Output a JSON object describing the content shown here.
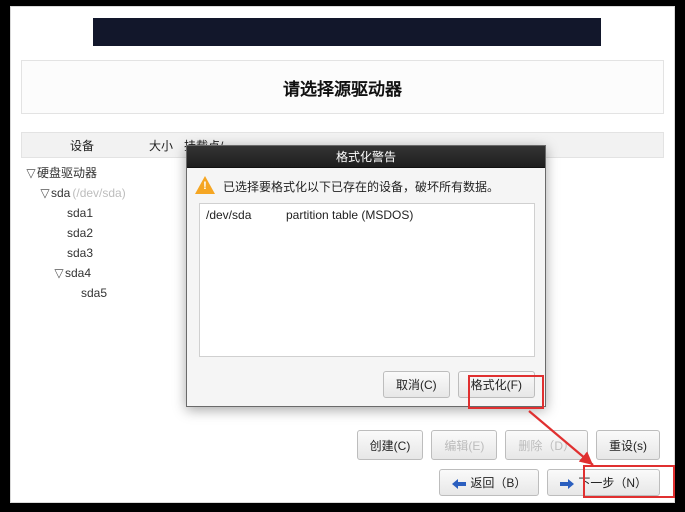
{
  "title_strip": "",
  "page_title": "请选择源驱动器",
  "columns": {
    "device": "设备",
    "size": "大小",
    "mount": "挂载点/"
  },
  "tree": {
    "root": "硬盘驱动器",
    "sda": "sda",
    "sda_dev": "(/dev/sda)",
    "p1": "sda1",
    "p2": "sda2",
    "p3": "sda3",
    "p4": "sda4",
    "p5": "sda5"
  },
  "dialog": {
    "title": "格式化警告",
    "message": "已选择要格式化以下已存在的设备，破坏所有数据。",
    "device": "/dev/sda",
    "desc": "partition table (MSDOS)",
    "cancel": "取消(C)",
    "format": "格式化(F)"
  },
  "buttons": {
    "create": "创建(C)",
    "edit": "编辑(E)",
    "delete": "删除（D）",
    "reset": "重设(s)",
    "back": "返回（B）",
    "next": "下一步（N）"
  }
}
